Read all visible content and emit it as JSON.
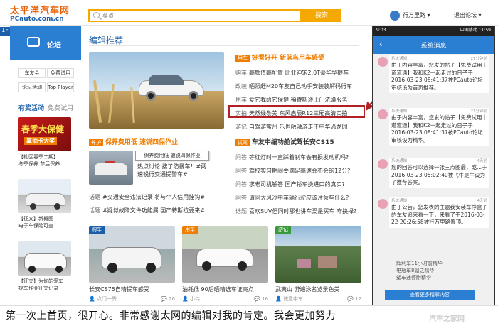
{
  "header": {
    "logo_main": "太平洋汽车网",
    "logo_sub": "PCauto.com.cn",
    "search_placeholder": "莫贞",
    "search_button": "搜索",
    "user_name": "行万里路",
    "user_menu": "退出论坛"
  },
  "left": {
    "floor": "1F",
    "forum_label": "论坛",
    "buttons": [
      "车友会",
      "免费试用",
      "论坛活动",
      "Top Player"
    ],
    "activity_title": "有奖活动",
    "activity_free": "免费试用",
    "promos": [
      {
        "banner": "春季大保健",
        "sub": "赢油卡大奖",
        "lines": [
          "【社区春季二期】",
          "冬季保养 节后保养"
        ]
      },
      {
        "banner": "",
        "sub": "",
        "lines": [
          "【征文】新概图",
          "电子车保险可查"
        ]
      },
      {
        "banner": "",
        "sub": "",
        "lines": [
          "【征文】为你的爱车",
          "提车作业征文记录"
        ]
      }
    ]
  },
  "main": {
    "section_title": "编辑推荐",
    "top_tag": "用车",
    "top_headline": "好看好开 新蓝鸟用车感受",
    "news": [
      {
        "cat": "购车",
        "text": "高颜值高配置 比亚迪宋2.0T豪华型提车"
      },
      {
        "cat": "改装",
        "text": "晒照赶M20车友自己动手安装装解码行车"
      },
      {
        "cat": "用车",
        "text": "爱它我给它保健 福睿斯逐上门洗澡服务"
      },
      {
        "cat": "实拍",
        "text": "天然线条美 东风启辰R12三厢高清实拍"
      },
      {
        "cat": "游记",
        "text": "自驾游常州 乐也融融游走于中华恐龙园"
      }
    ],
    "left_tag": "养护",
    "left_headline": "保养费用低 速锐四保作业",
    "tooltip": "保养费用低 速锐四保作业",
    "left_items": [
      {
        "title": "热点讨论 搜了防暴车！#两",
        "sub": "速锐行交通提警车#"
      },
      {
        "title": "话题",
        "text": "#交通安全违法记录 将与个人信用挂钩#"
      },
      {
        "title": "话题",
        "text": "#疑似故障文件功能属 国产特斯拉要来#"
      }
    ],
    "right_tag": "试驾",
    "right_headline": "车友中编功舱试驾长安CS15",
    "qa": [
      {
        "cat": "问答",
        "text": "等红灯时一直踩着刹车会有损发动机吗?"
      },
      {
        "cat": "问答",
        "text": "驾校实习期间要满足高速会不会的12分?"
      },
      {
        "cat": "问答",
        "text": "求老司机解答 国产轿车换进口的真实?"
      },
      {
        "cat": "问答",
        "text": "请问大风沙中车辆行驶应该注意些什么?"
      },
      {
        "cat": "话题",
        "text": "喜欢SUV但同时那也讲车爱是买车 咋抉择?"
      }
    ],
    "thumbs": [
      {
        "tag": "购车",
        "caption": "长安CS75自精提车感受",
        "author": "点门一秀",
        "count": "26"
      },
      {
        "tag": "用车",
        "caption": "油耗低 90后晒精选车证亮点",
        "author": "小伟",
        "count": "16"
      },
      {
        "tag": "游记",
        "caption": "武夷山 游遍泳名览景色美",
        "author": "诚意中车",
        "count": "12"
      }
    ]
  },
  "phone": {
    "status_left": "9:03",
    "status_right": "中国移动 11:59",
    "nav_title": "系统消息",
    "messages": [
      {
        "head": "系统通知",
        "time": "21分钟前",
        "text": "由于内容丰富，您发的帖子【免费试用｜道道通】我和K2一起走过的日子于2016-03-23 08:41:37被PCauto论坛审核设为首页推荐。"
      },
      {
        "head": "系统通知",
        "time": "21分钟前",
        "text": "由于内容丰富，您发的帖子【免费试用｜道道通】我和K2一起走过的日子于2016-03-23 08:41:37被PCauto论坛审核设为精华。"
      },
      {
        "head": "系统通知",
        "time": "4天前",
        "text": "您的回答可以选择一张三点图最，或...于2016-03-23 05:02:40被飞牛是牛设为了推荐答案。"
      },
      {
        "head": "系统通知",
        "time": "4天前",
        "text": "由于公告，您发表的主题我安装车挣盒子的车友追来看一下，来看了于2016-03-22 20:26:58被行万里路置顶。"
      }
    ],
    "extra_lines": [
      "辉利车11小时前精华",
      "电瓶车8副之精华",
      "塑车违停耐精华"
    ],
    "more_button": "查看更多精彩内容"
  },
  "caption": "第一次上首页，很开心。非常感谢太网的编辑对我的肯定。我会更加努力",
  "watermark": "汽车之家网"
}
